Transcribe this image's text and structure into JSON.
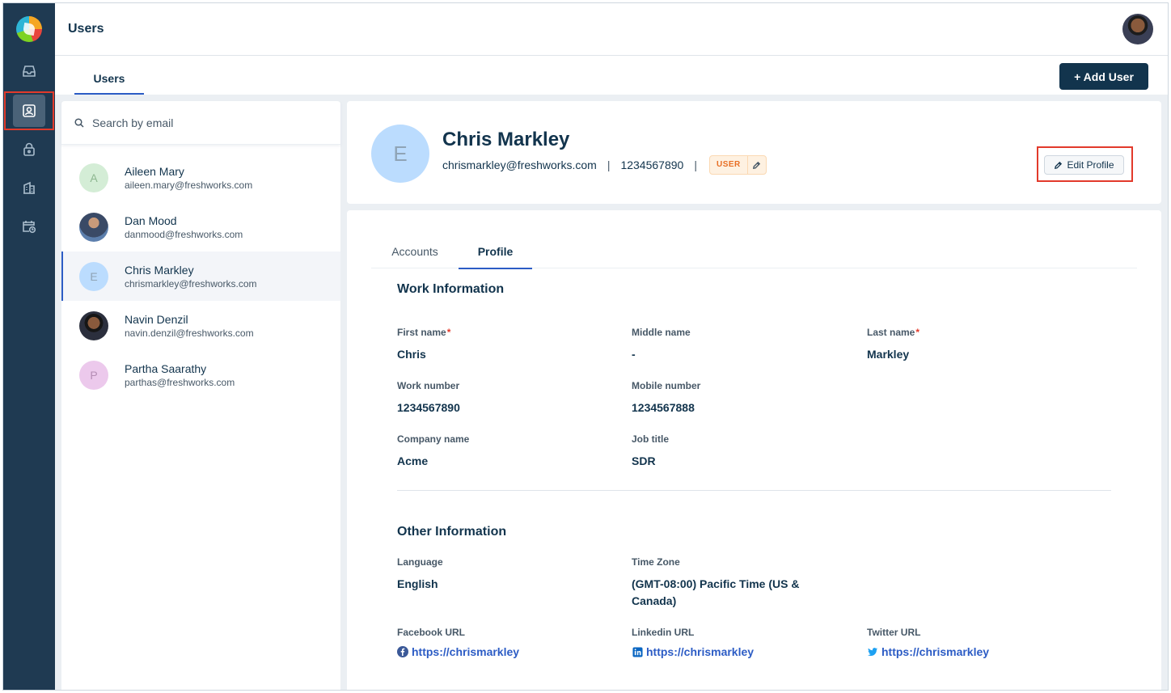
{
  "header": {
    "title": "Users"
  },
  "tabs": {
    "users": "Users"
  },
  "toolbar": {
    "add_user": "+ Add User"
  },
  "search": {
    "placeholder": "Search by email"
  },
  "users": [
    {
      "initial": "A",
      "name": "Aileen Mary",
      "email": "aileen.mary@freshworks.com",
      "avatar_color": "#d4edd6",
      "initial_color": "#8db790"
    },
    {
      "initial": "",
      "name": "Dan Mood",
      "email": "danmood@freshworks.com",
      "avatar_color": "#3e5d87",
      "initial_color": "#ffffff"
    },
    {
      "initial": "E",
      "name": "Chris Markley",
      "email": "chrismarkley@freshworks.com",
      "avatar_color": "#bbdcfe",
      "initial_color": "#8fa4b6",
      "selected": true
    },
    {
      "initial": "",
      "name": "Navin Denzil",
      "email": "navin.denzil@freshworks.com",
      "avatar_color": "#2b2f3d",
      "initial_color": "#ffffff"
    },
    {
      "initial": "P",
      "name": "Partha Saarathy",
      "email": "parthas@freshworks.com",
      "avatar_color": "#ecc9ec",
      "initial_color": "#b58db5"
    }
  ],
  "profile": {
    "initial": "E",
    "name": "Chris Markley",
    "email": "chrismarkley@freshworks.com",
    "phone": "1234567890",
    "role": "USER",
    "edit_label": "Edit Profile"
  },
  "detail_tabs": {
    "accounts": "Accounts",
    "profile": "Profile"
  },
  "work": {
    "title": "Work Information",
    "first_name": {
      "label": "First name",
      "value": "Chris"
    },
    "middle_name": {
      "label": "Middle name",
      "value": "-"
    },
    "last_name": {
      "label": "Last name",
      "value": "Markley"
    },
    "work_number": {
      "label": "Work number",
      "value": "1234567890"
    },
    "mobile_number": {
      "label": "Mobile number",
      "value": "1234567888"
    },
    "company_name": {
      "label": "Company name",
      "value": "Acme"
    },
    "job_title": {
      "label": "Job title",
      "value": "SDR"
    },
    "required_mark": "*"
  },
  "other": {
    "title": "Other Information",
    "language": {
      "label": "Language",
      "value": "English"
    },
    "time_zone": {
      "label": "Time Zone",
      "value": "(GMT-08:00) Pacific Time (US & Canada)"
    },
    "facebook": {
      "label": "Facebook URL",
      "value": "https://chrismarkley"
    },
    "linkedin": {
      "label": "Linkedin URL",
      "value": "https://chrismarkley"
    },
    "twitter": {
      "label": "Twitter URL",
      "value": "https://chrismarkley"
    }
  },
  "colors": {
    "primary": "#12344d",
    "accent": "#2c5cc5",
    "rail": "#1f3a52",
    "highlight": "#e23a2b"
  },
  "icons": [
    "freshworks-logo",
    "inbox-icon",
    "contact-icon",
    "lock-icon",
    "building-icon",
    "calendar-clock-icon",
    "search-icon",
    "pencil-icon",
    "facebook-icon",
    "linkedin-icon",
    "twitter-icon"
  ]
}
